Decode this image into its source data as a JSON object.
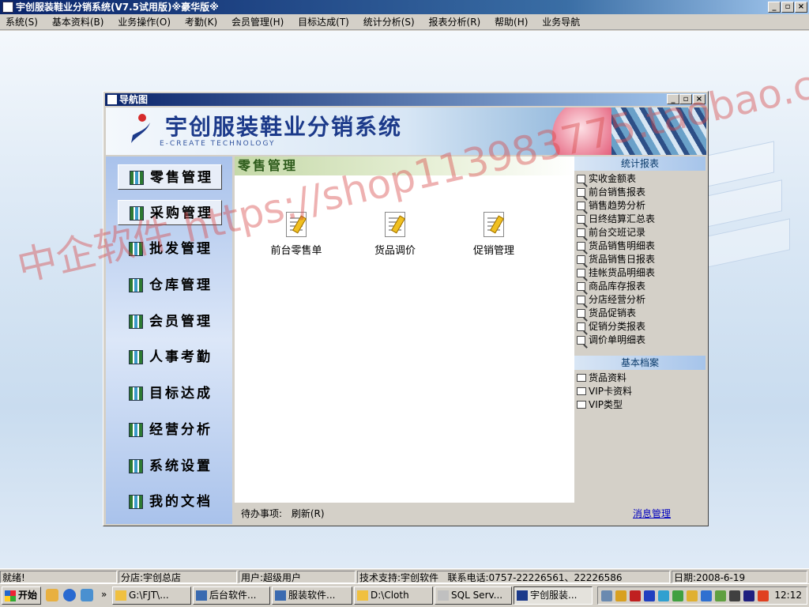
{
  "window": {
    "title": "宇创服装鞋业分销系统(V7.5试用版)※豪华版※",
    "min": "_",
    "max": "▫",
    "close": "×"
  },
  "menubar": [
    "系统(S)",
    "基本资料(B)",
    "业务操作(O)",
    "考勤(K)",
    "会员管理(H)",
    "目标达成(T)",
    "统计分析(S)",
    "报表分析(R)",
    "帮助(H)",
    "业务导航"
  ],
  "watermark": "中企软件 https://shop113983775.taobao.com",
  "nav": {
    "title": "导航图",
    "banner_title": "宇创服装鞋业分销系统",
    "banner_subtitle": "E-CREATE TECHNOLOGY",
    "left_items": [
      "零售管理",
      "采购管理",
      "批发管理",
      "仓库管理",
      "会员管理",
      "人事考勤",
      "目标达成",
      "经营分析",
      "系统设置",
      "我的文档"
    ],
    "content_title": "零售管理",
    "content_items": [
      "前台零售单",
      "货品调价",
      "促销管理"
    ],
    "todo_label": "待办事项:",
    "refresh_label": "刷新(R)",
    "stats_header": "统计报表",
    "stats_items": [
      "实收金额表",
      "前台销售报表",
      "销售趋势分析",
      "日终结算汇总表",
      "前台交班记录",
      "货品销售明细表",
      "货品销售日报表",
      "挂帐货品明细表",
      "商品库存报表",
      "分店经营分析",
      "货品促销表",
      "促销分类报表",
      "调价单明细表"
    ],
    "basic_header": "基本档案",
    "basic_items": [
      "货品资料",
      "VIP卡资料",
      "VIP类型"
    ],
    "msg_link": "消息管理"
  },
  "statusbar": {
    "ready": "就绪!",
    "branch": "分店:宇创总店",
    "user": "用户:超级用户",
    "support": "技术支持:宇创软件",
    "phone": "联系电话:0757-22226561、22226586",
    "date": "日期:2008-6-19"
  },
  "taskbar": {
    "start": "开始",
    "tasks": [
      "G:\\FJT\\...",
      "后台软件...",
      "服装软件...",
      "D:\\Cloth",
      "SQL Serv...",
      "宇创服装..."
    ],
    "chevron": "»",
    "clock": "12:12"
  }
}
